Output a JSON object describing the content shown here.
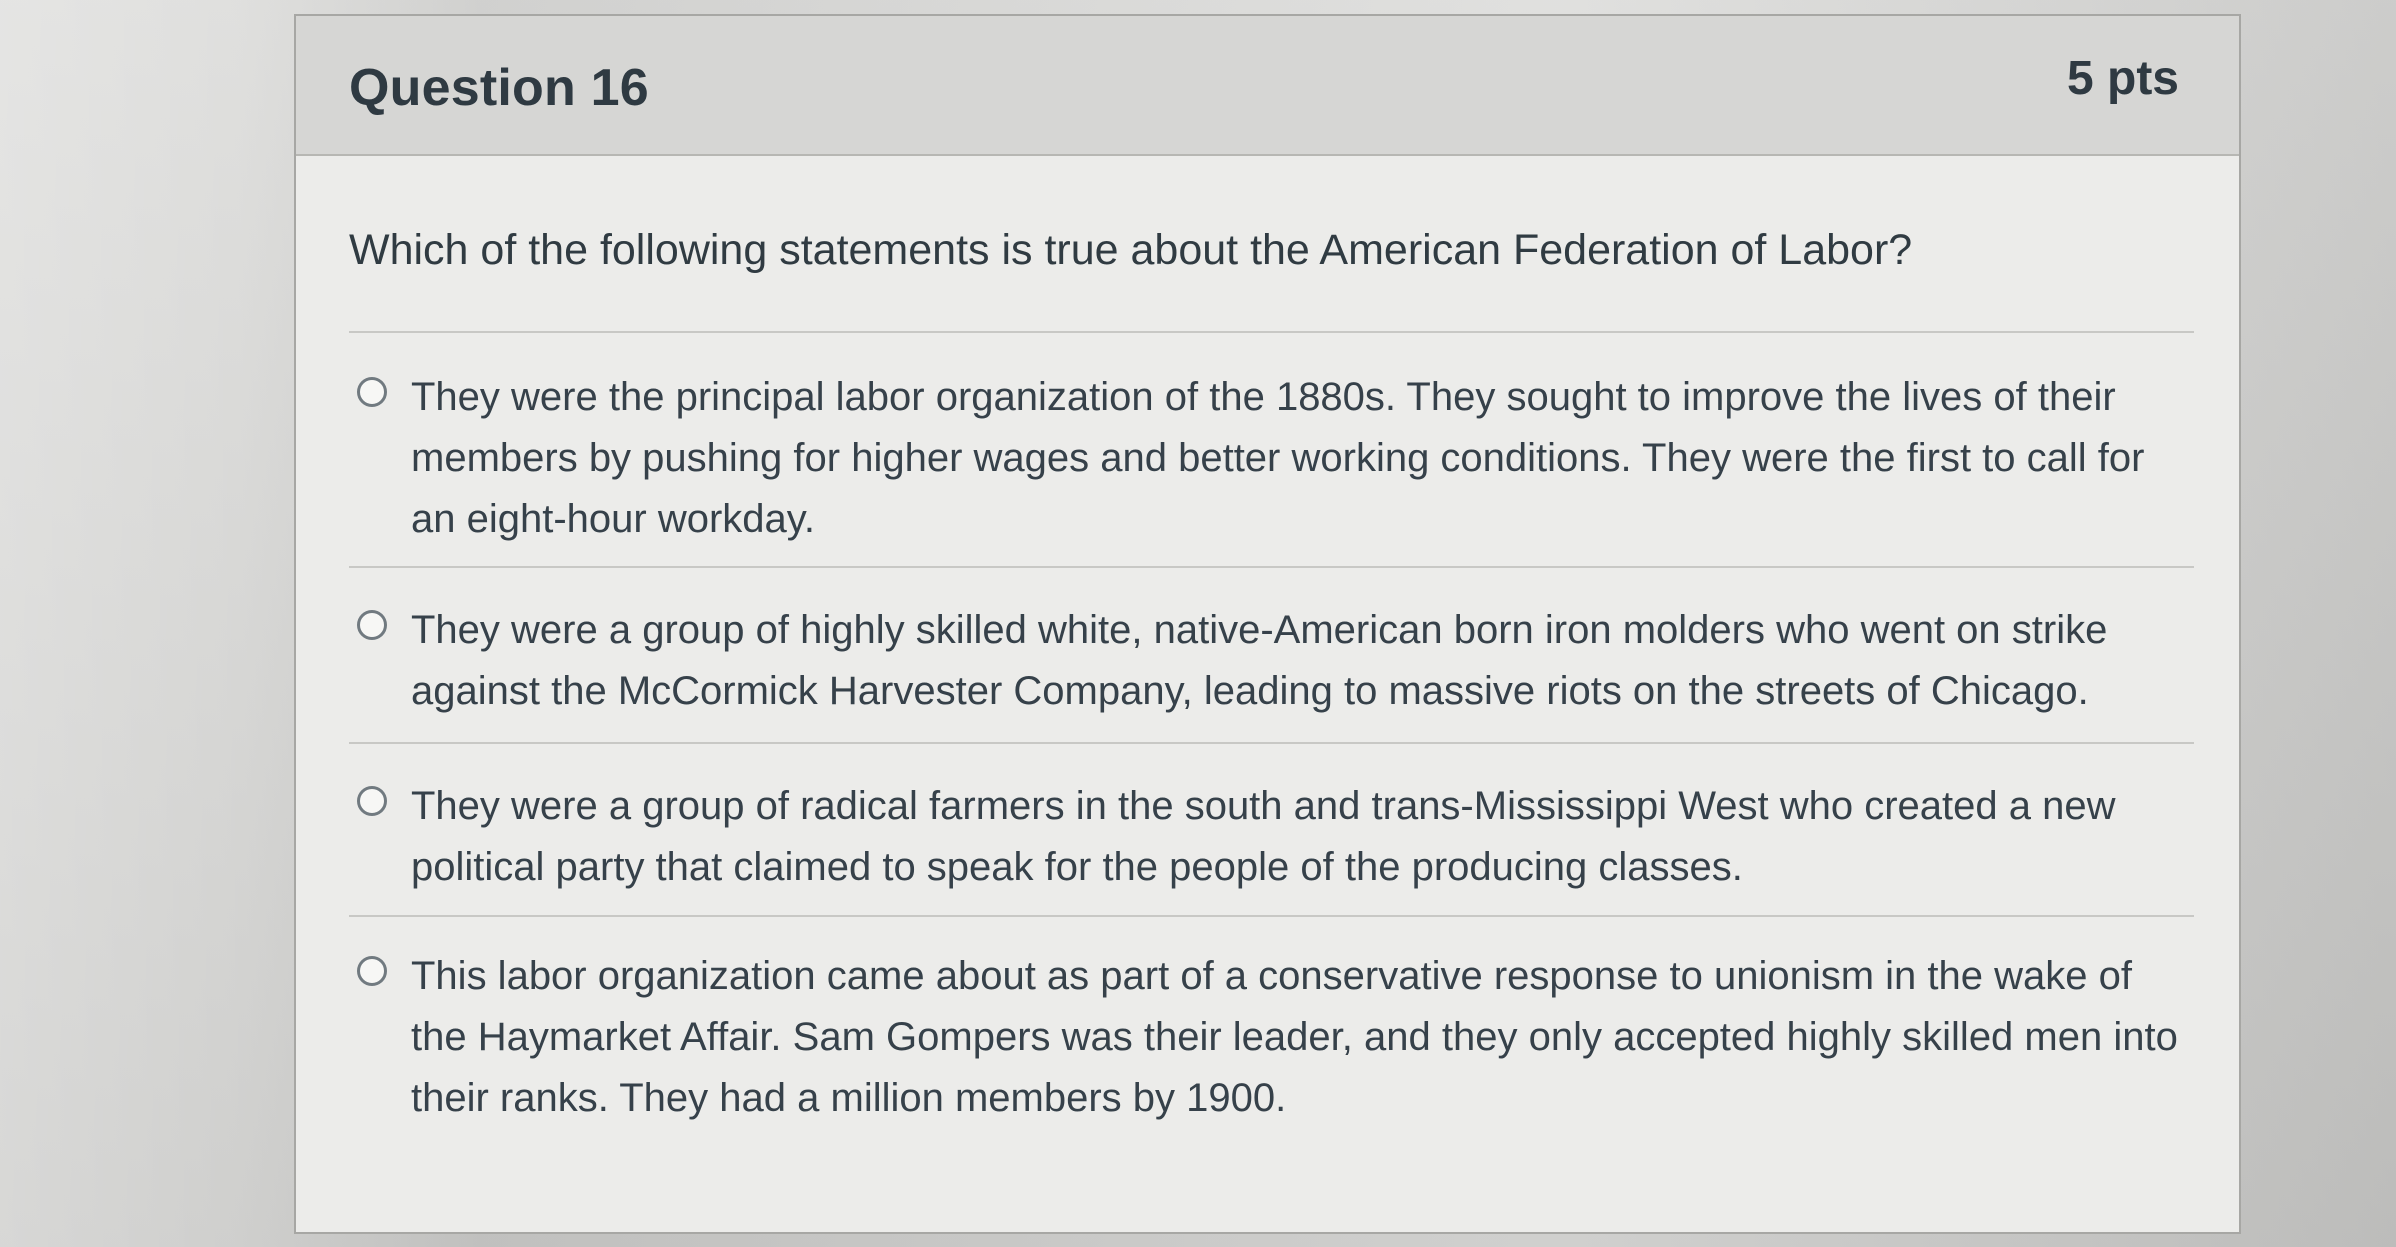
{
  "question": {
    "title": "Question 16",
    "points": "5 pts",
    "prompt": "Which of the following statements is true about the American Federation of Labor?",
    "options": [
      {
        "label": "They were the principal labor organization of the 1880s. They sought to improve the lives of their members by pushing for higher wages and better working conditions. They were the first to call for an eight-hour workday.",
        "selected": false
      },
      {
        "label": "They were a group of highly skilled white, native-American born iron molders who went on strike against the McCormick Harvester Company, leading to massive riots on the streets of Chicago.",
        "selected": false
      },
      {
        "label": "They were a group of radical farmers in the south and trans-Mississippi West who created a new political party that claimed to speak for the people of the producing classes.",
        "selected": false
      },
      {
        "label": "This labor organization came about as part of a conservative response to unionism in the wake of the Haymarket Affair. Sam Gompers was their leader, and they only accepted highly skilled men into their ranks. They had a million members by 1900.",
        "selected": false
      }
    ]
  }
}
